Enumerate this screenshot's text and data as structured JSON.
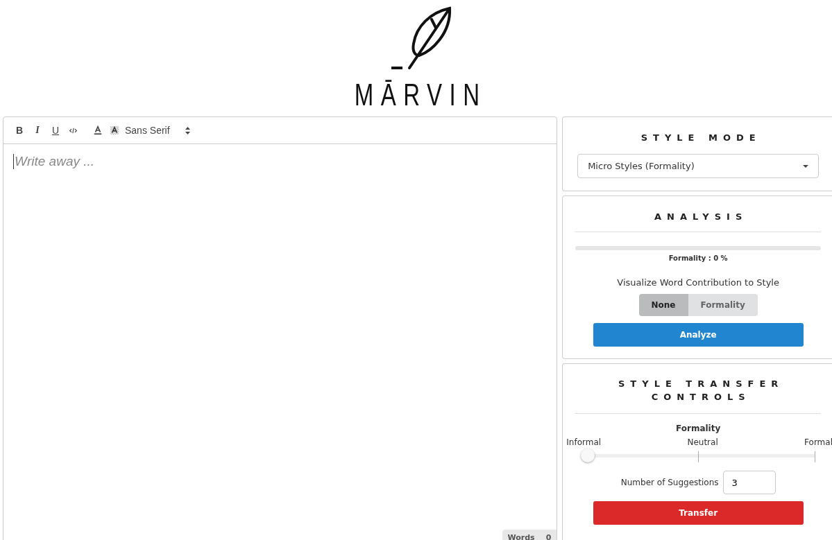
{
  "logo": {
    "name": "MĀRVIN"
  },
  "editor": {
    "toolbar": [
      {
        "kind": "bold",
        "label": "B"
      },
      {
        "kind": "italic",
        "label": "I"
      },
      {
        "kind": "underline",
        "label": "U"
      },
      {
        "kind": "code"
      },
      {
        "kind": "color"
      },
      {
        "kind": "background"
      }
    ],
    "font_picker": {
      "value": "Sans Serif"
    },
    "placeholder": "Write away ...",
    "word_count": {
      "label": "Words",
      "value": "0"
    }
  },
  "style_mode": {
    "title": "STYLE MODE",
    "select": {
      "value": "Micro Styles (Formality)"
    }
  },
  "analysis": {
    "title": "ANALYSIS",
    "meter": {
      "level": 0
    },
    "reading": "Formality : 0 %",
    "toggle_label": "Visualize Word Contribution to Style",
    "toggle": [
      {
        "label": "None",
        "selected": true
      },
      {
        "label": "Formality",
        "selected": false
      }
    ],
    "button": "Analyze"
  },
  "transfer": {
    "title_lines": [
      "STYLE TRANSFER",
      "CONTROLS"
    ],
    "slider_title": "Formality",
    "scale": [
      "Informal",
      "Neutral",
      "Formal"
    ],
    "slider": {
      "level": 0
    },
    "suggestions": {
      "label": "Number of Suggestions",
      "value": "3"
    },
    "button": "Transfer"
  }
}
